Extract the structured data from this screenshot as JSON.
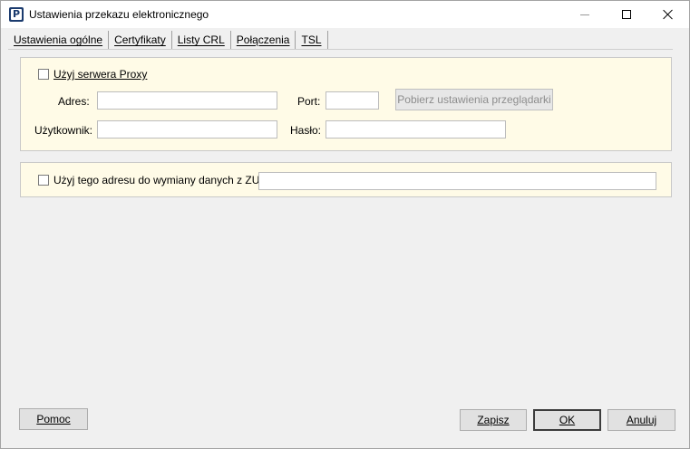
{
  "window": {
    "title": "Ustawienia przekazu elektronicznego",
    "app_icon_letter": "P"
  },
  "tabs": [
    {
      "label": "Ustawienia ogólne"
    },
    {
      "label": "Certyfikaty"
    },
    {
      "label": "Listy CRL"
    },
    {
      "label": "Połączenia",
      "active": true
    },
    {
      "label": "TSL"
    }
  ],
  "proxy": {
    "use_proxy_label": "Użyj serwera Proxy",
    "use_proxy_checked": false,
    "address_label": "Adres:",
    "address_value": "",
    "port_label": "Port:",
    "port_value": "",
    "fetch_browser_label": "Pobierz ustawienia przeglądarki",
    "user_label": "Użytkownik:",
    "user_value": "",
    "password_label": "Hasło:",
    "password_value": ""
  },
  "zus": {
    "use_address_label": "Użyj tego adresu do wymiany danych z ZUS:",
    "use_address_checked": false,
    "address_value": ""
  },
  "footer": {
    "help_label": "Pomoc",
    "save_label": "Zapisz",
    "ok_label": "OK",
    "cancel_label": "Anuluj"
  },
  "colors": {
    "group_background": "#fffbe7",
    "window_background": "#f0f0f0"
  }
}
